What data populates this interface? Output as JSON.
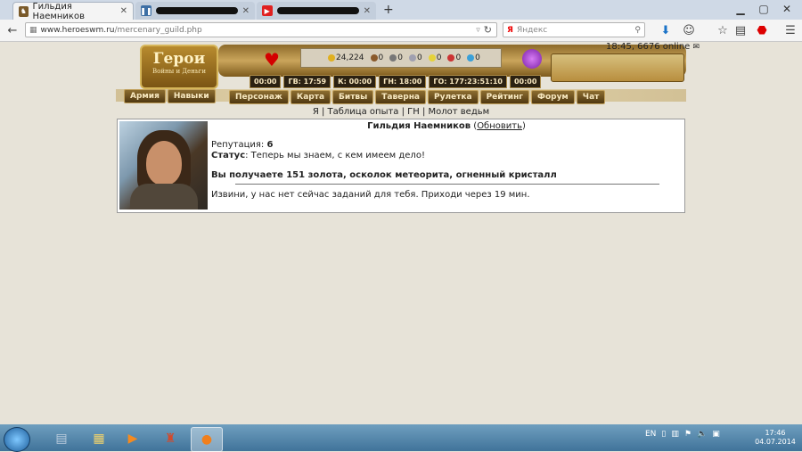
{
  "browser": {
    "tabs": [
      {
        "title": "Гильдия Наемников",
        "active": true
      },
      {
        "title": "",
        "active": false,
        "redacted": true
      },
      {
        "title": "",
        "active": false,
        "redacted": true
      }
    ],
    "new_tab": "+",
    "url_domain": "www.heroeswm.ru",
    "url_path": "/mercenary_guild.php",
    "search_placeholder": "Яндекс"
  },
  "game": {
    "logo_title": "Герои",
    "logo_subtitle": "Войны и Деньги",
    "time_online": "18:45, 6676 online",
    "resources": [
      {
        "name": "gold",
        "value": "24,224",
        "color": "#e0b020"
      },
      {
        "name": "wood",
        "value": "0",
        "color": "#8a5a2b"
      },
      {
        "name": "ore",
        "value": "0",
        "color": "#777777"
      },
      {
        "name": "mercury",
        "value": "0",
        "color": "#a0a0b0"
      },
      {
        "name": "sulfur",
        "value": "0",
        "color": "#e5d23a"
      },
      {
        "name": "crystal",
        "value": "0",
        "color": "#cc3333"
      },
      {
        "name": "gems",
        "value": "0",
        "color": "#3aa0d8"
      }
    ],
    "timers": [
      "00:00",
      "ГВ: 17:59",
      "К: 00:00",
      "ГН: 18:00",
      "ГО: 177:23:51:10",
      "00:00"
    ],
    "left_tabs": [
      "Армия",
      "Навыки"
    ],
    "main_tabs": [
      "Персонаж",
      "Карта",
      "Битвы",
      "Таверна",
      "Рулетка",
      "Рейтинг",
      "Форум",
      "Чат"
    ],
    "sublinks": [
      "Я",
      "Таблица опыта",
      "ГН",
      "Молот ведьм"
    ]
  },
  "guild": {
    "title": "Гильдия Наемников",
    "refresh_link": "Обновить",
    "reputation_label": "Репутация:",
    "reputation_value": "6",
    "status_label": "Статус",
    "status_text": ": Теперь мы знаем, с кем имеем дело!",
    "reward_text": "Вы получаете 151 золота, осколок метеорита, огненный кристалл",
    "message": "Извини, у нас нет сейчас заданий для тебя. Приходи через 19 мин."
  },
  "taskbar": {
    "language": "EN",
    "time": "17:46",
    "date": "04.07.2014"
  }
}
